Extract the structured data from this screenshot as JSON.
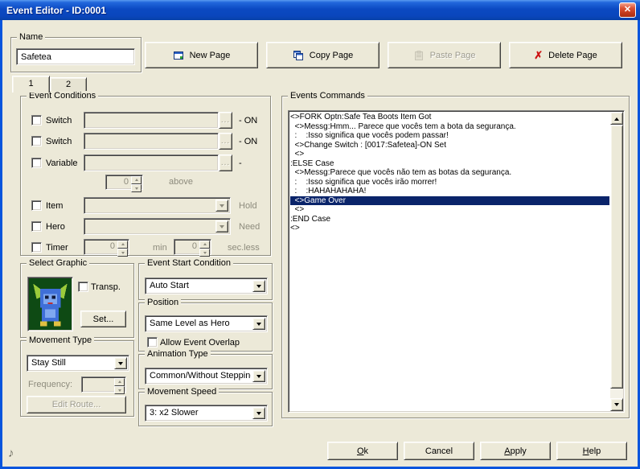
{
  "window": {
    "title": "Event Editor - ID:0001"
  },
  "icons": {
    "close": "✕",
    "delete_x": "✗",
    "note": "♪"
  },
  "colors": {
    "dialog_bg": "#ECE9D8",
    "selection_bg": "#0A246A",
    "titlebar_blue": "#0B49C2",
    "close_red": "#C23A1D"
  },
  "name_group": {
    "label": "Name",
    "value": "Safetea"
  },
  "page_buttons": {
    "new_label": "New Page",
    "copy_label": "Copy Page",
    "paste_label": "Paste Page",
    "delete_label": "Delete Page"
  },
  "tabs": [
    {
      "label": "1"
    },
    {
      "label": "2"
    }
  ],
  "event_conditions": {
    "label": "Event Conditions",
    "switch1_label": "Switch",
    "switch1_browse": "...",
    "switch1_suffix": "- ON",
    "switch2_label": "Switch",
    "switch2_browse": "...",
    "switch2_suffix": "- ON",
    "variable_label": "Variable",
    "variable_browse": "...",
    "variable_suffix": "-",
    "variable_spin_value": "0",
    "variable_above_label": "above",
    "item_label": "Item",
    "item_suffix": "Hold",
    "hero_label": "Hero",
    "hero_suffix": "Need",
    "timer_label": "Timer",
    "timer_min_value": "0",
    "timer_min_label": "min",
    "timer_sec_value": "0",
    "timer_suffix": "sec.less"
  },
  "select_graphic": {
    "label": "Select Graphic",
    "transp_label": "Transp.",
    "set_label": "Set..."
  },
  "movement_type": {
    "label": "Movement Type",
    "value": "Stay Still",
    "frequency_label": "Frequency:",
    "frequency_value": "",
    "edit_route_label": "Edit Route..."
  },
  "event_start": {
    "label": "Event Start Condition",
    "value": "Auto Start"
  },
  "position": {
    "label": "Position",
    "value": "Same Level as Hero",
    "overlap_label": "Allow Event Overlap"
  },
  "animation_type": {
    "label": "Animation Type",
    "value": "Common/Without Stepping"
  },
  "movement_speed": {
    "label": "Movement Speed",
    "value": "3: x2 Slower"
  },
  "events_commands": {
    "label": "Events Commands",
    "lines": [
      {
        "text": "<>FORK Optn:Safe Tea Boots Item Got",
        "selected": false
      },
      {
        "text": "  <>Messg:Hmm... Parece que vocês tem a bota da segurança.",
        "selected": false
      },
      {
        "text": "  :    :Isso significa que vocês podem passar!",
        "selected": false
      },
      {
        "text": "  <>Change Switch : [0017:Safetea]-ON Set",
        "selected": false
      },
      {
        "text": "  <>",
        "selected": false
      },
      {
        "text": ":ELSE Case",
        "selected": false
      },
      {
        "text": "  <>Messg:Parece que vocês não tem as botas da segurança.",
        "selected": false
      },
      {
        "text": "  :    :Isso significa que vocês irão morrer!",
        "selected": false
      },
      {
        "text": "  :    :HAHAHAHAHA!",
        "selected": false
      },
      {
        "text": "  <>Game Over",
        "selected": true
      },
      {
        "text": "  <>",
        "selected": false
      },
      {
        "text": ":END Case",
        "selected": false
      },
      {
        "text": "<>",
        "selected": false
      }
    ]
  },
  "footer": {
    "ok_label": "Ok",
    "cancel_label": "Cancel",
    "apply_label": "Apply",
    "help_label": "Help"
  }
}
